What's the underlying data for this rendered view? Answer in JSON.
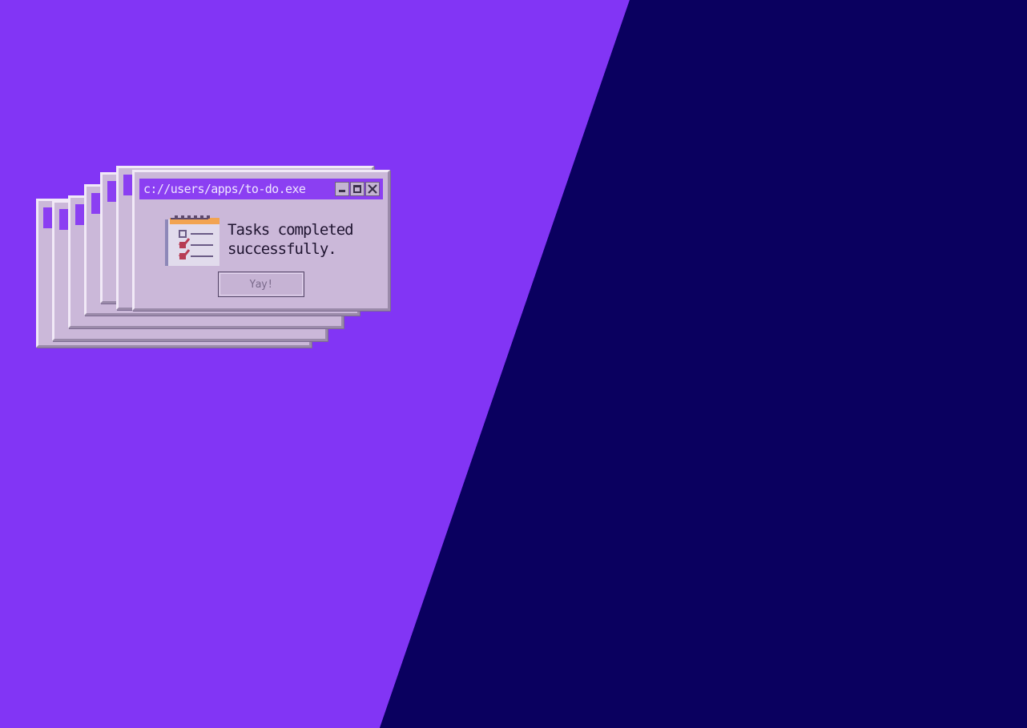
{
  "background": {
    "left_color": "#8235f5",
    "right_color": "#0a005f"
  },
  "dialog": {
    "title": "c://users/apps/to-do.exe",
    "message_line1": "Tasks completed",
    "message_line2": "successfully.",
    "button_label": "Yay!",
    "icon": "checklist-icon",
    "controls": [
      "minimize-icon",
      "maximize-icon",
      "close-icon"
    ],
    "accent_color": "#8b3ff2",
    "body_color": "#cbb8d9"
  },
  "stack": {
    "trailing_window_count": 6
  }
}
